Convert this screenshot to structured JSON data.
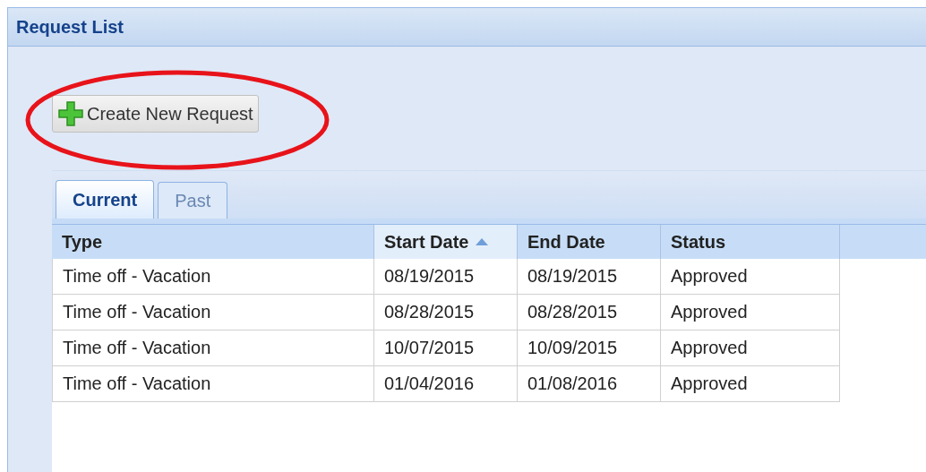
{
  "panel": {
    "title": "Request List"
  },
  "toolbar": {
    "button": "Create New Request",
    "highlighted": true
  },
  "tabs": [
    {
      "label": "Current",
      "selected": true
    },
    {
      "label": "Past",
      "selected": false
    }
  ],
  "table": {
    "columns": [
      {
        "label": "Type",
        "sorted": false
      },
      {
        "label": "Start Date",
        "sorted": true
      },
      {
        "label": "End Date",
        "sorted": false
      },
      {
        "label": "Status",
        "sorted": false
      }
    ],
    "rows": [
      [
        "Time off - Vacation",
        "08/19/2015",
        "08/19/2015",
        "Approved"
      ],
      [
        "Time off - Vacation",
        "08/28/2015",
        "08/28/2015",
        "Approved"
      ],
      [
        "Time off - Vacation",
        "10/07/2015",
        "10/09/2015",
        "Approved"
      ],
      [
        "Time off - Vacation",
        "01/04/2016",
        "01/08/2016",
        "Approved"
      ]
    ]
  }
}
